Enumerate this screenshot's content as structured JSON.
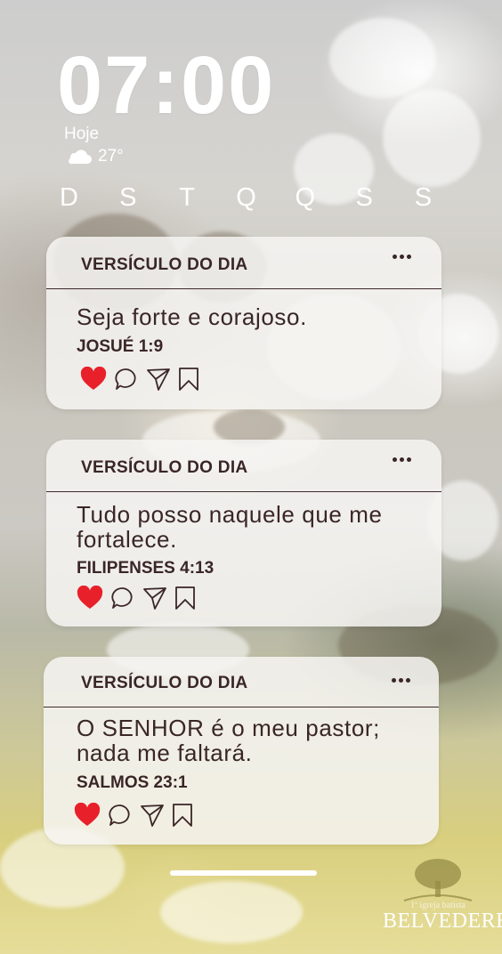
{
  "lockscreen": {
    "time": "07:00",
    "date_label": "Hoje",
    "temperature": "27°",
    "weather_icon": "cloud-icon",
    "weekdays": [
      "D",
      "S",
      "T",
      "Q",
      "Q",
      "S",
      "S"
    ]
  },
  "cards": [
    {
      "title": "VERSÍCULO DO DIA",
      "verse": "Seja forte e corajoso.",
      "reference": "JOSUÉ 1:9",
      "liked": true
    },
    {
      "title": "VERSÍCULO DO DIA",
      "verse": "Tudo posso naquele que me fortalece.",
      "reference": "FILIPENSES 4:13",
      "liked": true
    },
    {
      "title": "VERSÍCULO DO DIA",
      "verse": "O SENHOR é o meu pastor; nada me faltará.",
      "reference": "SALMOS 23:1",
      "liked": true
    }
  ],
  "logo": {
    "small_text": "1ª igreja batista",
    "main_text": "BELVEDERE"
  },
  "colors": {
    "text_dark": "#3a2626",
    "heart": "#e8202a",
    "card_bg": "#f6f4f2"
  }
}
